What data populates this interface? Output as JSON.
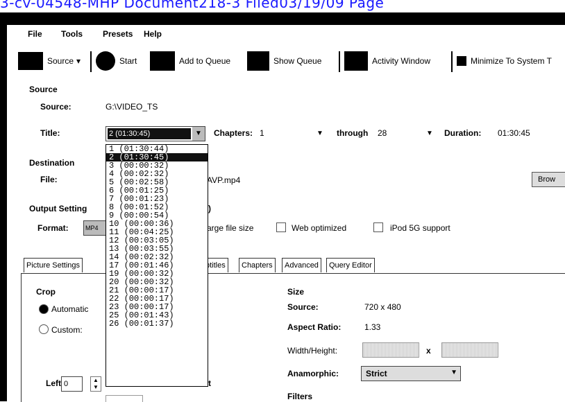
{
  "header_text": "3-cv-04548-MHP   Document218-3   Filed03/19/09   Page",
  "menu": [
    "File",
    "Tools",
    "Presets",
    "Help"
  ],
  "toolbar": {
    "source": "Source",
    "start": "Start",
    "add_to_queue": "Add to Queue",
    "show_queue": "Show Queue",
    "activity_window": "Activity Window",
    "minimize": "Minimize To System T"
  },
  "source_section": {
    "heading": "Source",
    "source_label": "Source:",
    "source_value": "G:\\VIDEO_TS",
    "title_label": "Title:",
    "chapters_label": "Chapters:",
    "chapters_from": "1",
    "through_label": "through",
    "chapters_to": "28",
    "duration_label": "Duration:",
    "duration_value": "01:30:45"
  },
  "title_options": [
    "1 (01:30:44)",
    "2 (01:30:45)",
    "3 (00:00:32)",
    "4 (00:02:32)",
    "5 (00:02:58)",
    "6 (00:01:25)",
    "7 (00:01:23)",
    "8 (00:01:52)",
    "9 (00:00:54)",
    "10 (00:00:36)",
    "11 (00:04:25)",
    "12 (00:03:05)",
    "13 (00:03:55)",
    "14 (00:02:32)",
    "17 (00:01:46)",
    "19 (00:00:32)",
    "20 (00:00:32)",
    "21 (00:00:17)",
    "22 (00:00:17)",
    "23 (00:00:17)",
    "25 (00:01:43)",
    "26 (00:01:37)"
  ],
  "destination": {
    "heading": "Destination",
    "file_label": "File:",
    "file_value_suffix": "AVP.mp4",
    "browse": "Brow"
  },
  "output": {
    "heading": "Output Setting",
    "format_label": "Format:",
    "format_value": "MP4",
    "paren": ")",
    "large_file": "arge file size",
    "web_optimized": "Web optimized",
    "ipod": "iPod 5G support"
  },
  "tabs": [
    "Picture Settings",
    "btitles",
    "Chapters",
    "Advanced",
    "Query Editor"
  ],
  "picture": {
    "crop_heading": "Crop",
    "automatic": "Automatic",
    "custom": "Custom:",
    "left_label": "Left",
    "left_value": "0",
    "size_heading": "Size",
    "source_label": "Source:",
    "source_value": "720 x 480",
    "aspect_label": "Aspect Ratio:",
    "aspect_value": "1.33",
    "wh_label": "Width/Height:",
    "x_sep": "x",
    "anamorphic_label": "Anamorphic:",
    "anamorphic_value": "Strict",
    "filters_heading": "Filters",
    "partial_t": "t"
  }
}
